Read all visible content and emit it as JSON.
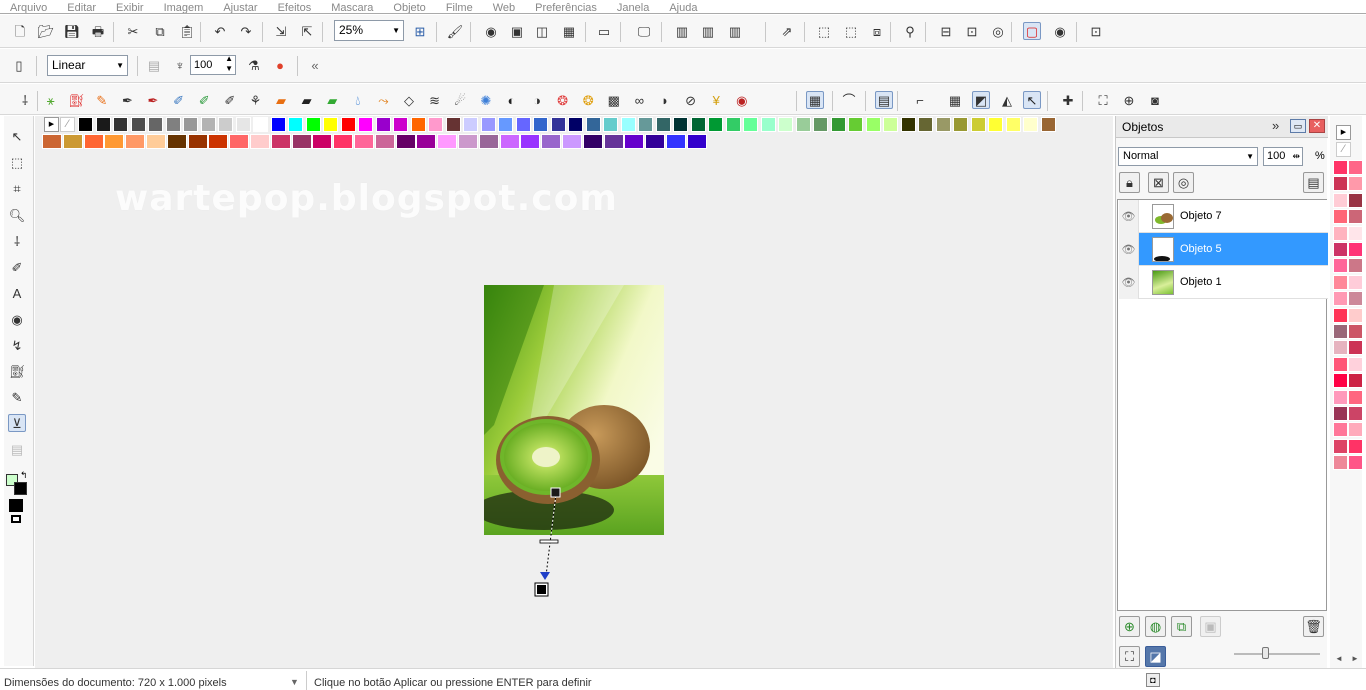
{
  "menu": [
    "Arquivo",
    "Editar",
    "Exibir",
    "Imagem",
    "Ajustar",
    "Efeitos",
    "Mascara",
    "Objeto",
    "Filme",
    "Web",
    "Preferências",
    "Janela",
    "Ajuda"
  ],
  "toolbar1": {
    "zoom_value": "25%"
  },
  "toolbar2": {
    "blend_mode": "Linear",
    "opacity_value": "100"
  },
  "watermark": "wartepop.blogspot.com",
  "objects_panel": {
    "title": "Objetos",
    "blend_mode": "Normal",
    "opacity_value": "100",
    "opacity_unit": "%",
    "layers": [
      {
        "name": "Objeto 7",
        "selected": false
      },
      {
        "name": "Objeto 5",
        "selected": true
      },
      {
        "name": "Objeto 1",
        "selected": false
      }
    ]
  },
  "status": {
    "doc_size": "Dimensões do documento: 720 x 1.000 pixels",
    "hint": "Clique no botão Aplicar ou pressione ENTER para definir"
  },
  "colors": {
    "accent": "#3399ff",
    "palette_row1": [
      "#000000",
      "#1a1a1a",
      "#333333",
      "#4d4d4d",
      "#666666",
      "#808080",
      "#999999",
      "#b3b3b3",
      "#cccccc",
      "#e6e6e6",
      "#ffffff",
      "#0000ff",
      "#00ffff",
      "#00ff00",
      "#ffff00",
      "#ff0000",
      "#ff00ff",
      "#9900cc",
      "#cc00cc",
      "#ff6600",
      "#ff99cc",
      "#663333",
      "#ccccff",
      "#9999ff",
      "#6699ff",
      "#6666ff",
      "#3366cc",
      "#333399",
      "#000066",
      "#336699",
      "#66cccc",
      "#99ffff",
      "#669999",
      "#336666",
      "#003333",
      "#006633",
      "#009933",
      "#33cc66",
      "#66ff99",
      "#99ffcc",
      "#ccffcc",
      "#99cc99",
      "#669966",
      "#339933",
      "#66cc33",
      "#99ff66",
      "#ccff99",
      "#333300",
      "#666633",
      "#999966",
      "#999933",
      "#cccc33",
      "#ffff33",
      "#ffff66",
      "#ffffcc",
      "#996633"
    ],
    "palette_row2": [
      "#cc6633",
      "#cc9933",
      "#ff6633",
      "#ff9933",
      "#ff9966",
      "#ffcc99",
      "#663300",
      "#993300",
      "#cc3300",
      "#ff6666",
      "#ffcccc",
      "#cc3366",
      "#993366",
      "#cc0066",
      "#ff3366",
      "#ff6699",
      "#cc6699",
      "#660066",
      "#990099",
      "#ff99ff",
      "#cc99cc",
      "#996699",
      "#cc66ff",
      "#9933ff",
      "#9966cc",
      "#cc99ff",
      "#330066",
      "#663399",
      "#6600cc",
      "#330099",
      "#3333ff",
      "#3300cc"
    ],
    "right_palette": [
      "#ff3366",
      "#ff6688",
      "#cc3355",
      "#ff99aa",
      "#ffccd5",
      "#993344",
      "#ff6677",
      "#cc6677",
      "#ffb3bf",
      "#ffe5ea",
      "#cc3366",
      "#ff3377",
      "#ff6699",
      "#cc7788",
      "#ff8899",
      "#ffccd9",
      "#ff99b3",
      "#cc8899",
      "#ff3355",
      "#ffcccc",
      "#996677",
      "#cc5566",
      "#e6b3bf",
      "#cc3355",
      "#ff5577",
      "#ffd1dc",
      "#ff0044",
      "#cc2244",
      "#ff99bb",
      "#ff6680",
      "#993355",
      "#cc4466",
      "#ff7799",
      "#ffaabb",
      "#dd4466",
      "#ff3366",
      "#ee8899",
      "#ff5588"
    ]
  },
  "icons": {
    "toolbar1": [
      "new-icon",
      "open-icon",
      "save-icon",
      "print-icon",
      "cut-icon",
      "copy-icon",
      "paste-icon",
      "undo-icon",
      "redo-icon",
      "import-icon",
      "export-icon",
      "fit-window-icon",
      "brush-icon",
      "eye-icon",
      "frame-icon",
      "layers-icon",
      "grid-icon",
      "display-icon",
      "monitor-icon",
      "filmstrip-icon",
      "filmstrip2-icon",
      "filmstrip3-icon",
      "select-arrow-icon",
      "group-icon",
      "ungroup-icon",
      "arrange-icon",
      "magnet-icon",
      "align-icon",
      "duplicate-icon",
      "mask-icon",
      "frame-border-icon",
      "preview-icon",
      "export2-icon"
    ],
    "toolbar3": [
      "dropper-icon",
      "wand-icon",
      "bucket-icon",
      "pencil-icon",
      "pen-icon",
      "pen2-icon",
      "brush2-icon",
      "brush3-icon",
      "brush4-icon",
      "spray-icon",
      "marker-icon",
      "crayon-icon",
      "chalk-icon",
      "drop-icon",
      "smudge-icon",
      "eraser-icon",
      "smear-icon",
      "blur-icon",
      "sponge-icon",
      "dodge-icon",
      "contrast-icon",
      "color-wheel-icon",
      "color-wheel2-icon",
      "sponge2-icon",
      "goggles-icon",
      "fish-icon",
      "clone-icon",
      "tint-icon",
      "red-eye-icon",
      "grid-tool-icon",
      "wave-icon",
      "panel-icon",
      "ruler-icon",
      "grid2-icon",
      "frame2-icon",
      "snap-icon",
      "cursor-icon",
      "plus-icon",
      "fullscreen-icon",
      "zoom-fit-icon",
      "view-icon"
    ],
    "left_tools": [
      "pick-tool-icon",
      "marquee-tool-icon",
      "crop-tool-icon",
      "zoom-tool-icon",
      "eyedropper-tool-icon",
      "retouch-tool-icon",
      "text-tool-icon",
      "redeye-tool-icon",
      "shape-tool-icon",
      "fill-tool-icon",
      "brush-tool-icon",
      "transparency-tool-icon",
      "clone-tool-icon"
    ]
  },
  "ids": {
    "toolbar1": [
      "tb1-new",
      "tb1-open",
      "tb1-save",
      "tb1-print",
      "tb1-cut",
      "tb1-copy",
      "tb1-paste",
      "tb1-undo",
      "tb1-redo",
      "tb1-import",
      "tb1-export",
      "tb1-fit",
      "tb1-brush",
      "tb1-eye",
      "tb1-frame",
      "tb1-layers",
      "tb1-grid",
      "tb1-display",
      "tb1-monitor",
      "tb1-film",
      "tb1-film2",
      "tb1-film3",
      "tb1-select",
      "tb1-group",
      "tb1-ungroup",
      "tb1-arrange",
      "tb1-magnet",
      "tb1-align",
      "tb1-dup",
      "tb1-mask",
      "tb1-border",
      "tb1-preview",
      "tb1-export2"
    ],
    "toolbar3": [
      "tb3-1",
      "tb3-2",
      "tb3-3",
      "tb3-4",
      "tb3-5",
      "tb3-6",
      "tb3-7",
      "tb3-8",
      "tb3-9",
      "tb3-10",
      "tb3-11",
      "tb3-12",
      "tb3-13",
      "tb3-14",
      "tb3-15",
      "tb3-16",
      "tb3-17",
      "tb3-18",
      "tb3-19",
      "tb3-20",
      "tb3-21",
      "tb3-22",
      "tb3-23",
      "tb3-24",
      "tb3-25",
      "tb3-26",
      "tb3-27",
      "tb3-28",
      "tb3-29",
      "tb3-30",
      "tb3-31",
      "tb3-32",
      "tb3-33",
      "tb3-34",
      "tb3-35",
      "tb3-36",
      "tb3-37",
      "tb3-38",
      "tb3-39",
      "tb3-40",
      "tb3-41"
    ],
    "left_tools": [
      "lt-1",
      "lt-2",
      "lt-3",
      "lt-4",
      "lt-5",
      "lt-6",
      "lt-7",
      "lt-8",
      "lt-9",
      "lt-10",
      "lt-11",
      "lt-12",
      "lt-13"
    ]
  }
}
